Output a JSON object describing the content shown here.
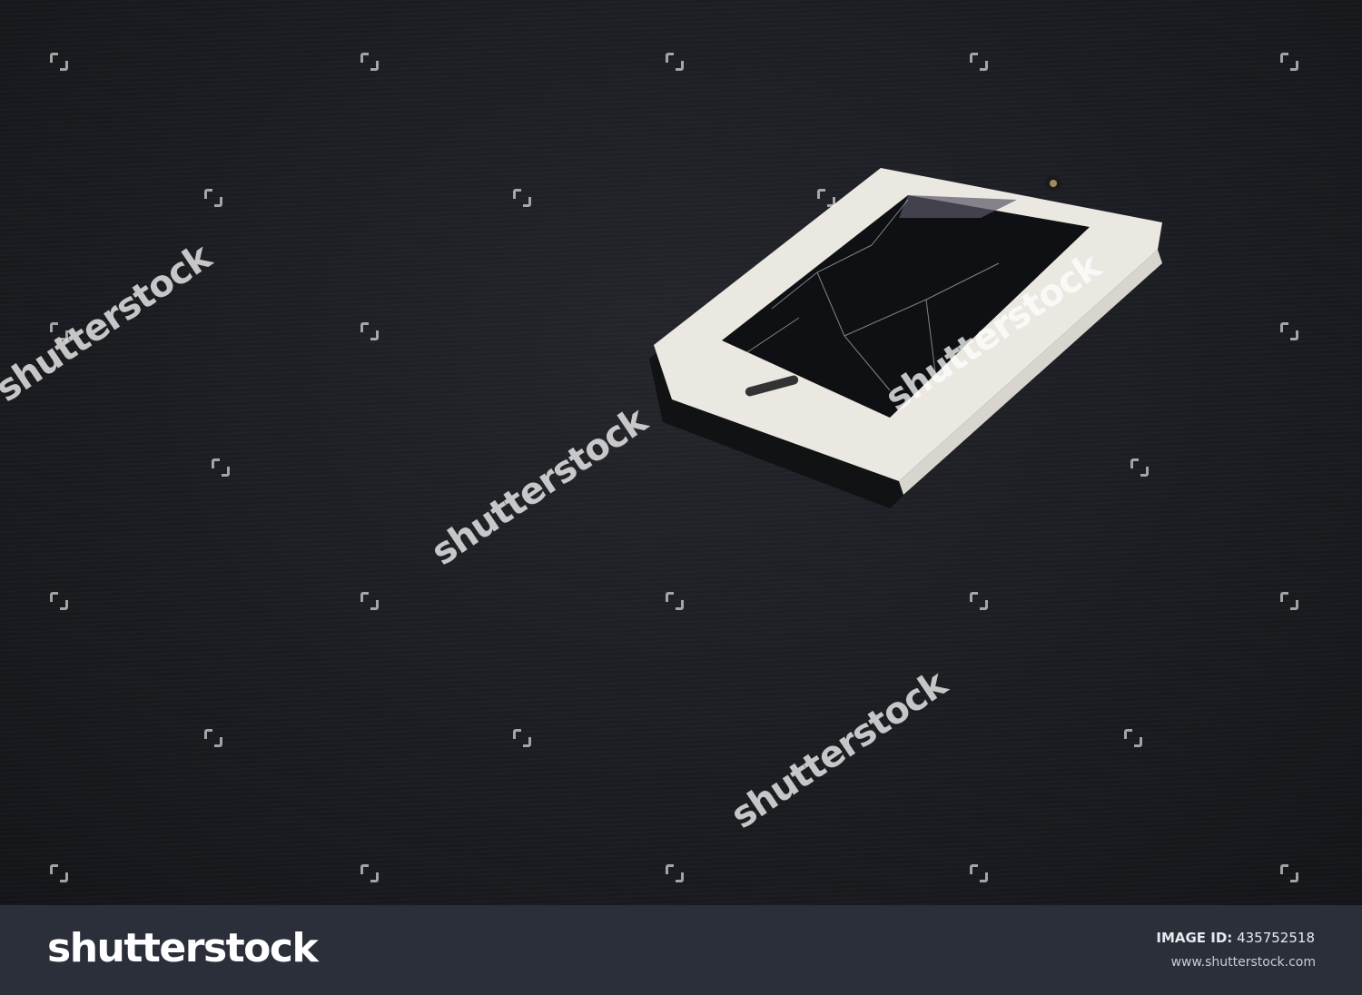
{
  "watermark": {
    "text": "shutterstock",
    "logo_text": "shutterstock"
  },
  "footer": {
    "image_id_label": "IMAGE ID:",
    "image_id": "435752518",
    "website": "www.shutterstock.com"
  },
  "colors": {
    "footer_bg": "#2a2f3a",
    "background": "#1b1d22",
    "phone_body": "#e9e6e0"
  }
}
